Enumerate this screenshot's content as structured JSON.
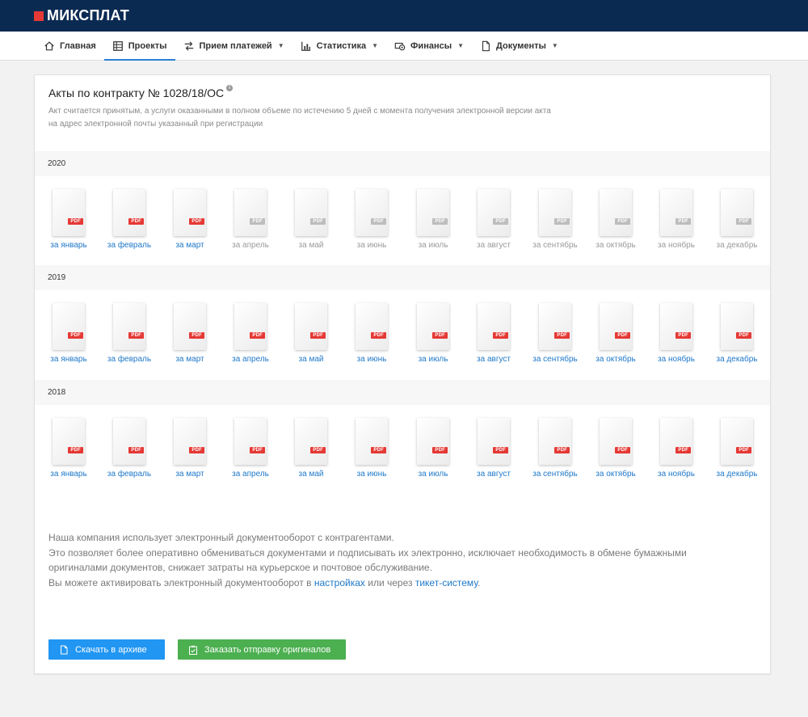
{
  "brand": {
    "logo_text": "МИКСПЛАТ",
    "logo_color": "#e53935",
    "bar_color": "#0b2a52"
  },
  "nav": {
    "items": [
      {
        "label": "Главная",
        "icon": "home-icon",
        "dropdown": false,
        "active": false
      },
      {
        "label": "Проекты",
        "icon": "table-icon",
        "dropdown": false,
        "active": true
      },
      {
        "label": "Прием платежей",
        "icon": "payments-icon",
        "dropdown": true,
        "active": false
      },
      {
        "label": "Статистика",
        "icon": "chart-icon",
        "dropdown": true,
        "active": false
      },
      {
        "label": "Финансы",
        "icon": "money-icon",
        "dropdown": true,
        "active": false
      },
      {
        "label": "Документы",
        "icon": "documents-icon",
        "dropdown": true,
        "active": false
      }
    ]
  },
  "card": {
    "title": "Акты по контракту № 1028/18/ОС",
    "info_icon": "i",
    "description_line1": "Акт считается принятым, а услуги оказанными в полном объеме по истечению 5 дней с момента получения электронной версии акта",
    "description_line2": "на адрес электронной почты указанный при регистрации"
  },
  "pdf_label": "PDF",
  "colors": {
    "active_link": "#1e78c9",
    "inactive_label": "#9a9a9a",
    "pdf_active": "#e53935",
    "pdf_inactive": "#bdbdbd",
    "accent": "#2a7fd4"
  },
  "years": [
    {
      "year": "2020",
      "months": [
        {
          "label": "за январь",
          "available": true
        },
        {
          "label": "за февраль",
          "available": true
        },
        {
          "label": "за март",
          "available": true
        },
        {
          "label": "за апрель",
          "available": false
        },
        {
          "label": "за май",
          "available": false
        },
        {
          "label": "за июнь",
          "available": false
        },
        {
          "label": "за июль",
          "available": false
        },
        {
          "label": "за август",
          "available": false
        },
        {
          "label": "за сентябрь",
          "available": false
        },
        {
          "label": "за октябрь",
          "available": false
        },
        {
          "label": "за ноябрь",
          "available": false
        },
        {
          "label": "за декабрь",
          "available": false
        }
      ]
    },
    {
      "year": "2019",
      "months": [
        {
          "label": "за январь",
          "available": true
        },
        {
          "label": "за февраль",
          "available": true
        },
        {
          "label": "за март",
          "available": true
        },
        {
          "label": "за апрель",
          "available": true
        },
        {
          "label": "за май",
          "available": true
        },
        {
          "label": "за июнь",
          "available": true
        },
        {
          "label": "за июль",
          "available": true
        },
        {
          "label": "за август",
          "available": true
        },
        {
          "label": "за сентябрь",
          "available": true
        },
        {
          "label": "за октябрь",
          "available": true
        },
        {
          "label": "за ноябрь",
          "available": true
        },
        {
          "label": "за декабрь",
          "available": true
        }
      ]
    },
    {
      "year": "2018",
      "months": [
        {
          "label": "за январь",
          "available": true
        },
        {
          "label": "за февраль",
          "available": true
        },
        {
          "label": "за март",
          "available": true
        },
        {
          "label": "за апрель",
          "available": true
        },
        {
          "label": "за май",
          "available": true
        },
        {
          "label": "за июнь",
          "available": true
        },
        {
          "label": "за июль",
          "available": true
        },
        {
          "label": "за август",
          "available": true
        },
        {
          "label": "за сентябрь",
          "available": true
        },
        {
          "label": "за октябрь",
          "available": true
        },
        {
          "label": "за ноябрь",
          "available": true
        },
        {
          "label": "за декабрь",
          "available": true
        }
      ]
    }
  ],
  "footer": {
    "line1": "Наша компания использует электронный документооборот с контрагентами.",
    "line2": "Это позволяет более оперативно обмениваться документами и подписывать их электронно, исключает необходимость в обмене бумажными",
    "line3": "оригиналами документов, снижает затраты на курьерское и почтовое обслуживание.",
    "line4_prefix": "Вы можете активировать электронный документооборот в ",
    "settings_link": "настройках",
    "line4_mid": " или через ",
    "ticket_link": "тикет-систему",
    "line4_suffix": "."
  },
  "buttons": {
    "download_label": "Скачать в архиве",
    "download_icon": "file-download-icon",
    "download_color": "#2196f3",
    "order_label": "Заказать отправку оригиналов",
    "order_icon": "clipboard-check-icon",
    "order_color": "#4caf50"
  }
}
